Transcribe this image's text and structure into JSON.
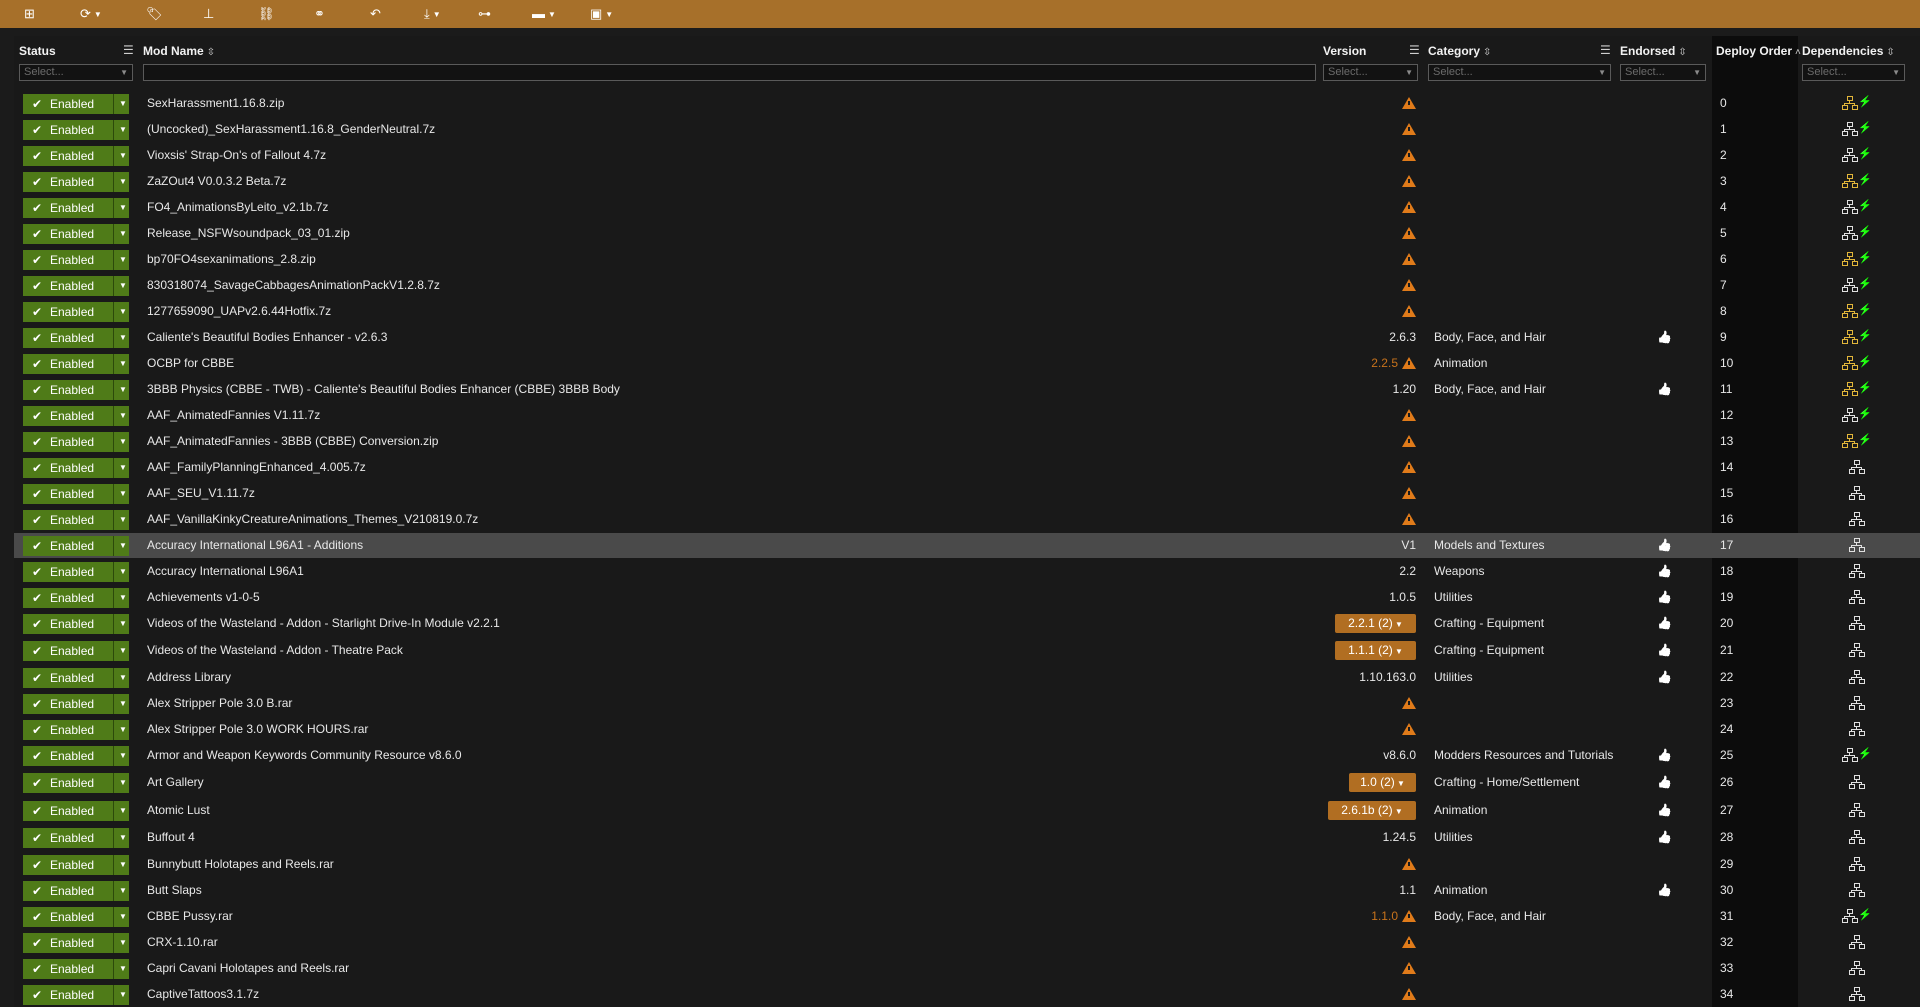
{
  "colors": {
    "toolbar": "#a7702a",
    "enabled": "#4f7b18",
    "warning": "#e07b1a",
    "version_pill": "#b16e22",
    "dep_warn": "#e2b63a",
    "dep_ok": "#e0e0e0",
    "bolt": "#4caf30"
  },
  "toolbar": {
    "buttons": [
      {
        "icon": "add-icon",
        "glyph": "⊞",
        "dropdown": false
      },
      {
        "icon": "refresh-icon",
        "glyph": "⟳",
        "dropdown": true
      },
      {
        "icon": "tag-icon",
        "glyph": "🏷",
        "dropdown": false
      },
      {
        "icon": "hierarchy-icon",
        "glyph": "⊥",
        "dropdown": false
      },
      {
        "icon": "link-icon",
        "glyph": "⛓",
        "dropdown": false
      },
      {
        "icon": "unlink-icon",
        "glyph": "⚭",
        "dropdown": false
      },
      {
        "icon": "undo-icon",
        "glyph": "↶",
        "dropdown": false
      },
      {
        "icon": "download-icon",
        "glyph": "⤓",
        "dropdown": true
      },
      {
        "icon": "tree-icon",
        "glyph": "⊶",
        "dropdown": false
      },
      {
        "icon": "folder-icon",
        "glyph": "▬",
        "dropdown": true
      },
      {
        "icon": "screen-icon",
        "glyph": "▣",
        "dropdown": true
      }
    ]
  },
  "headers": {
    "status": "Status",
    "mod_name": "Mod Name",
    "version": "Version",
    "category": "Category",
    "endorsed": "Endorsed",
    "deploy_order": "Deploy Order",
    "dependencies": "Dependencies"
  },
  "filters": {
    "status": "Select...",
    "version": "Select...",
    "category": "Select...",
    "endorsed": "Select...",
    "dependencies": "Select...",
    "mod_name": ""
  },
  "status_label": "Enabled",
  "rows": [
    {
      "name": "SexHarassment1.16.8.zip",
      "version": "",
      "vwarn": true,
      "category": "",
      "endorsed": false,
      "order": "0",
      "dep": "warn"
    },
    {
      "name": "(Uncocked)_SexHarassment1.16.8_GenderNeutral.7z",
      "version": "",
      "vwarn": true,
      "category": "",
      "endorsed": false,
      "order": "1",
      "dep": "bolt"
    },
    {
      "name": "Vioxsis' Strap-On's of Fallout 4.7z",
      "version": "",
      "vwarn": true,
      "category": "",
      "endorsed": false,
      "order": "2",
      "dep": "bolt"
    },
    {
      "name": "ZaZOut4 V0.0.3.2 Beta.7z",
      "version": "",
      "vwarn": true,
      "category": "",
      "endorsed": false,
      "order": "3",
      "dep": "warn"
    },
    {
      "name": "FO4_AnimationsByLeito_v2.1b.7z",
      "version": "",
      "vwarn": true,
      "category": "",
      "endorsed": false,
      "order": "4",
      "dep": "bolt"
    },
    {
      "name": "Release_NSFWsoundpack_03_01.zip",
      "version": "",
      "vwarn": true,
      "category": "",
      "endorsed": false,
      "order": "5",
      "dep": "bolt"
    },
    {
      "name": "bp70FO4sexanimations_2.8.zip",
      "version": "",
      "vwarn": true,
      "category": "",
      "endorsed": false,
      "order": "6",
      "dep": "warn"
    },
    {
      "name": "830318074_SavageCabbagesAnimationPackV1.2.8.7z",
      "version": "",
      "vwarn": true,
      "category": "",
      "endorsed": false,
      "order": "7",
      "dep": "bolt"
    },
    {
      "name": "1277659090_UAPv2.6.44Hotfix.7z",
      "version": "",
      "vwarn": true,
      "category": "",
      "endorsed": false,
      "order": "8",
      "dep": "warn"
    },
    {
      "name": "Caliente's Beautiful Bodies Enhancer - v2.6.3",
      "version": "2.6.3",
      "vwarn": false,
      "category": "Body, Face, and Hair",
      "endorsed": true,
      "order": "9",
      "dep": "warn"
    },
    {
      "name": "OCBP for CBBE",
      "version": "2.2.5",
      "vcolor": "orange",
      "vwarn": true,
      "category": "Animation",
      "endorsed": false,
      "order": "10",
      "dep": "warn"
    },
    {
      "name": "3BBB Physics (CBBE - TWB) - Caliente's Beautiful Bodies Enhancer (CBBE) 3BBB Body",
      "version": "1.20",
      "vwarn": false,
      "category": "Body, Face, and Hair",
      "endorsed": true,
      "order": "11",
      "dep": "warn"
    },
    {
      "name": "AAF_AnimatedFannies V1.11.7z",
      "version": "",
      "vwarn": true,
      "category": "",
      "endorsed": false,
      "order": "12",
      "dep": "bolt"
    },
    {
      "name": "AAF_AnimatedFannies - 3BBB (CBBE) Conversion.zip",
      "version": "",
      "vwarn": true,
      "category": "",
      "endorsed": false,
      "order": "13",
      "dep": "warn"
    },
    {
      "name": "AAF_FamilyPlanningEnhanced_4.005.7z",
      "version": "",
      "vwarn": true,
      "category": "",
      "endorsed": false,
      "order": "14",
      "dep": "plain"
    },
    {
      "name": "AAF_SEU_V1.11.7z",
      "version": "",
      "vwarn": true,
      "category": "",
      "endorsed": false,
      "order": "15",
      "dep": "plain"
    },
    {
      "name": "AAF_VanillaKinkyCreatureAnimations_Themes_V210819.0.7z",
      "version": "",
      "vwarn": true,
      "category": "",
      "endorsed": false,
      "order": "16",
      "dep": "plain"
    },
    {
      "name": "Accuracy International L96A1 - Additions",
      "version": "V1",
      "vwarn": false,
      "category": "Models and Textures",
      "endorsed": true,
      "order": "17",
      "dep": "plain",
      "selected": true
    },
    {
      "name": "Accuracy International L96A1",
      "version": "2.2",
      "vwarn": false,
      "category": "Weapons",
      "endorsed": true,
      "order": "18",
      "dep": "plain"
    },
    {
      "name": "Achievements v1-0-5",
      "version": "1.0.5",
      "vwarn": false,
      "category": "Utilities",
      "endorsed": true,
      "order": "19",
      "dep": "plain"
    },
    {
      "name": "Videos of the Wasteland - Addon - Starlight Drive-In Module v2.2.1",
      "pill": "2.2.1 (2)",
      "vwarn": false,
      "category": "Crafting - Equipment",
      "endorsed": true,
      "order": "20",
      "dep": "plain"
    },
    {
      "name": "Videos of the Wasteland - Addon - Theatre Pack",
      "pill": "1.1.1 (2)",
      "vwarn": false,
      "category": "Crafting - Equipment",
      "endorsed": true,
      "order": "21",
      "dep": "plain"
    },
    {
      "name": "Address Library",
      "version": "1.10.163.0",
      "vwarn": false,
      "category": "Utilities",
      "endorsed": true,
      "order": "22",
      "dep": "plain"
    },
    {
      "name": "Alex Stripper Pole 3.0 B.rar",
      "version": "",
      "vwarn": true,
      "category": "",
      "endorsed": false,
      "order": "23",
      "dep": "plain"
    },
    {
      "name": "Alex Stripper Pole 3.0 WORK HOURS.rar",
      "version": "",
      "vwarn": true,
      "category": "",
      "endorsed": false,
      "order": "24",
      "dep": "plain"
    },
    {
      "name": "Armor and Weapon Keywords Community Resource v8.6.0",
      "version": "v8.6.0",
      "vwarn": false,
      "category": "Modders Resources and Tutorials",
      "endorsed": true,
      "order": "25",
      "dep": "bolt"
    },
    {
      "name": "Art Gallery",
      "pill": "1.0 (2)",
      "vwarn": false,
      "category": "Crafting - Home/Settlement",
      "endorsed": true,
      "order": "26",
      "dep": "plain"
    },
    {
      "name": "Atomic Lust",
      "pill": "2.6.1b (2)",
      "vwarn": false,
      "category": "Animation",
      "endorsed": true,
      "order": "27",
      "dep": "plain"
    },
    {
      "name": "Buffout 4",
      "version": "1.24.5",
      "vwarn": false,
      "category": "Utilities",
      "endorsed": true,
      "order": "28",
      "dep": "plain"
    },
    {
      "name": "Bunnybutt Holotapes and Reels.rar",
      "version": "",
      "vwarn": true,
      "category": "",
      "endorsed": false,
      "order": "29",
      "dep": "plain"
    },
    {
      "name": "Butt Slaps",
      "version": "1.1",
      "vwarn": false,
      "category": "Animation",
      "endorsed": true,
      "order": "30",
      "dep": "plain"
    },
    {
      "name": "CBBE Pussy.rar",
      "version": "1.1.0",
      "vcolor": "orange",
      "vwarn": true,
      "category": "Body, Face, and Hair",
      "endorsed": false,
      "order": "31",
      "dep": "bolt"
    },
    {
      "name": "CRX-1.10.rar",
      "version": "",
      "vwarn": true,
      "category": "",
      "endorsed": false,
      "order": "32",
      "dep": "plain"
    },
    {
      "name": "Capri Cavani Holotapes and Reels.rar",
      "version": "",
      "vwarn": true,
      "category": "",
      "endorsed": false,
      "order": "33",
      "dep": "plain"
    },
    {
      "name": "CaptiveTattoos3.1.7z",
      "version": "",
      "vwarn": true,
      "category": "",
      "endorsed": false,
      "order": "34",
      "dep": "plain"
    }
  ]
}
